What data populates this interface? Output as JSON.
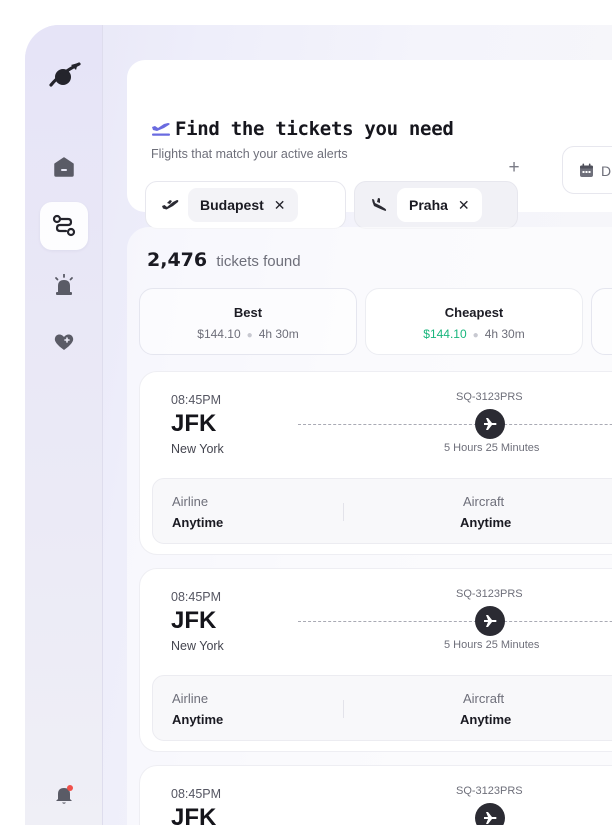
{
  "colors": {
    "accent": "#6a6be0",
    "positive": "#19b67d",
    "sidebar_icon": "#24242c",
    "notification_dot": "#f0504a"
  },
  "sidebar": {
    "logo": "planet-logo-icon",
    "items": [
      {
        "icon": "home-icon",
        "active": false
      },
      {
        "icon": "route-icon",
        "active": true
      },
      {
        "icon": "alarm-icon",
        "active": false
      },
      {
        "icon": "heart-plus-icon",
        "active": false
      }
    ],
    "bottom_icon": "bell-icon"
  },
  "search": {
    "title": "Find the tickets you need",
    "subtitle": "Flights that match your active alerts",
    "from": {
      "icon": "plane-departure-icon",
      "value": "Budapest"
    },
    "to": {
      "icon": "plane-arrival-icon",
      "value": "Praha"
    },
    "clear_glyph": "✕",
    "add_glyph": "+",
    "date": {
      "icon": "calendar-icon",
      "label": "D"
    }
  },
  "results": {
    "count": "2,476",
    "count_label": "tickets found",
    "sort_tabs": [
      {
        "title": "Best",
        "price": "$144.10",
        "duration": "4h 30m",
        "active": false,
        "price_highlight": false
      },
      {
        "title": "Cheapest",
        "price": "$144.10",
        "duration": "4h 30m",
        "active": true,
        "price_highlight": true
      }
    ],
    "tickets": [
      {
        "time": "08:45PM",
        "code": "JFK",
        "city": "New York",
        "flight_no": "SQ-3123PRS",
        "duration": "5 Hours 25 Minutes",
        "airline_label": "Airline",
        "airline_value": "Anytime",
        "aircraft_label": "Aircraft",
        "aircraft_value": "Anytime"
      },
      {
        "time": "08:45PM",
        "code": "JFK",
        "city": "New York",
        "flight_no": "SQ-3123PRS",
        "duration": "5 Hours 25 Minutes",
        "airline_label": "Airline",
        "airline_value": "Anytime",
        "aircraft_label": "Aircraft",
        "aircraft_value": "Anytime"
      },
      {
        "time": "08:45PM",
        "code": "JFK",
        "flight_no": "SQ-3123PRS"
      }
    ]
  }
}
